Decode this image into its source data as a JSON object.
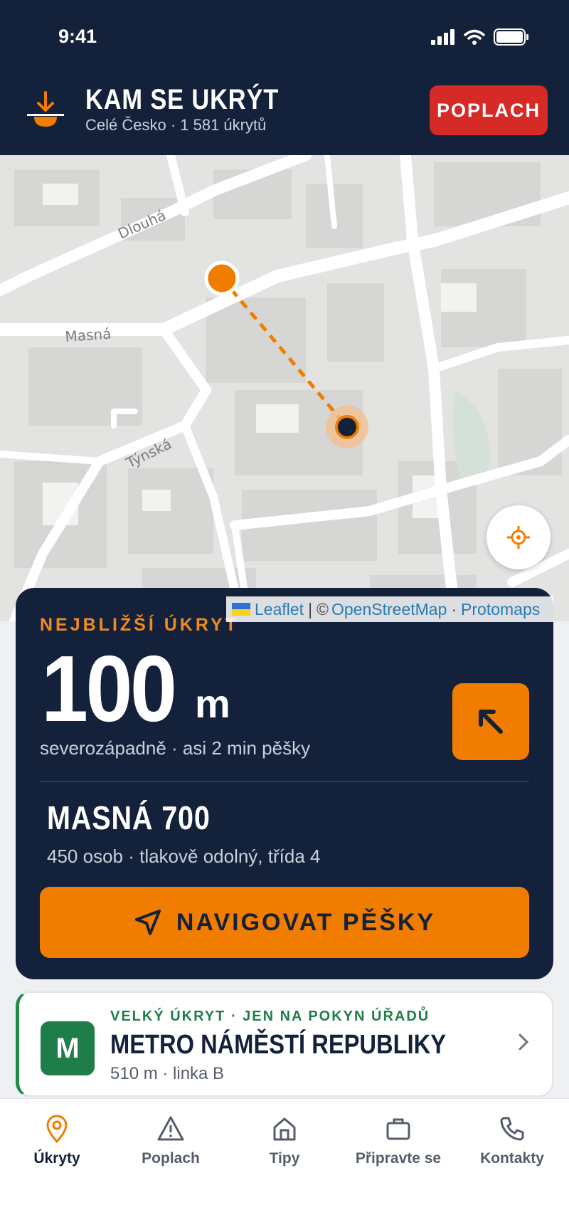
{
  "status_bar": {
    "time": "9:41"
  },
  "header": {
    "title": "KAM SE UKRÝT",
    "subtitle": "Celé Česko · 1 581 úkrytů",
    "alarm_button": "POPLACH"
  },
  "map": {
    "street_labels": [
      "Dlouhá",
      "Masná",
      "Týnská"
    ],
    "attribution": {
      "leaflet": "Leaflet",
      "separator": "|",
      "copyright": "©",
      "osm": "OpenStreetMap",
      "dot": "·",
      "protomaps": "Protomaps"
    }
  },
  "nearest": {
    "label": "NEJBLIŽŠÍ ÚKRYT",
    "distance": "100",
    "unit": "m",
    "direction_text": "severozápadně · asi 2 min pěšky",
    "shelter_name": "MASNÁ 700",
    "shelter_info": "450 osob · tlakově odolný, třída 4",
    "navigate_button": "NAVIGOVAT PĚŠKY"
  },
  "metro_card": {
    "badge": "M",
    "tag": "VELKÝ ÚKRYT · JEN NA POKYN ÚŘADŮ",
    "name": "METRO NÁMĚSTÍ REPUBLIKY",
    "info": "510 m · linka B"
  },
  "bottom_nav": {
    "items": [
      {
        "label": "Úkryty",
        "icon": "pin-icon",
        "active": true
      },
      {
        "label": "Poplach",
        "icon": "warning-icon"
      },
      {
        "label": "Tipy",
        "icon": "home-icon"
      },
      {
        "label": "Připravte se",
        "icon": "briefcase-icon"
      },
      {
        "label": "Kontakty",
        "icon": "phone-icon"
      }
    ]
  },
  "colors": {
    "navy": "#14213a",
    "orange": "#f07d00",
    "red": "#d62a27",
    "green": "#1f7d4a"
  }
}
